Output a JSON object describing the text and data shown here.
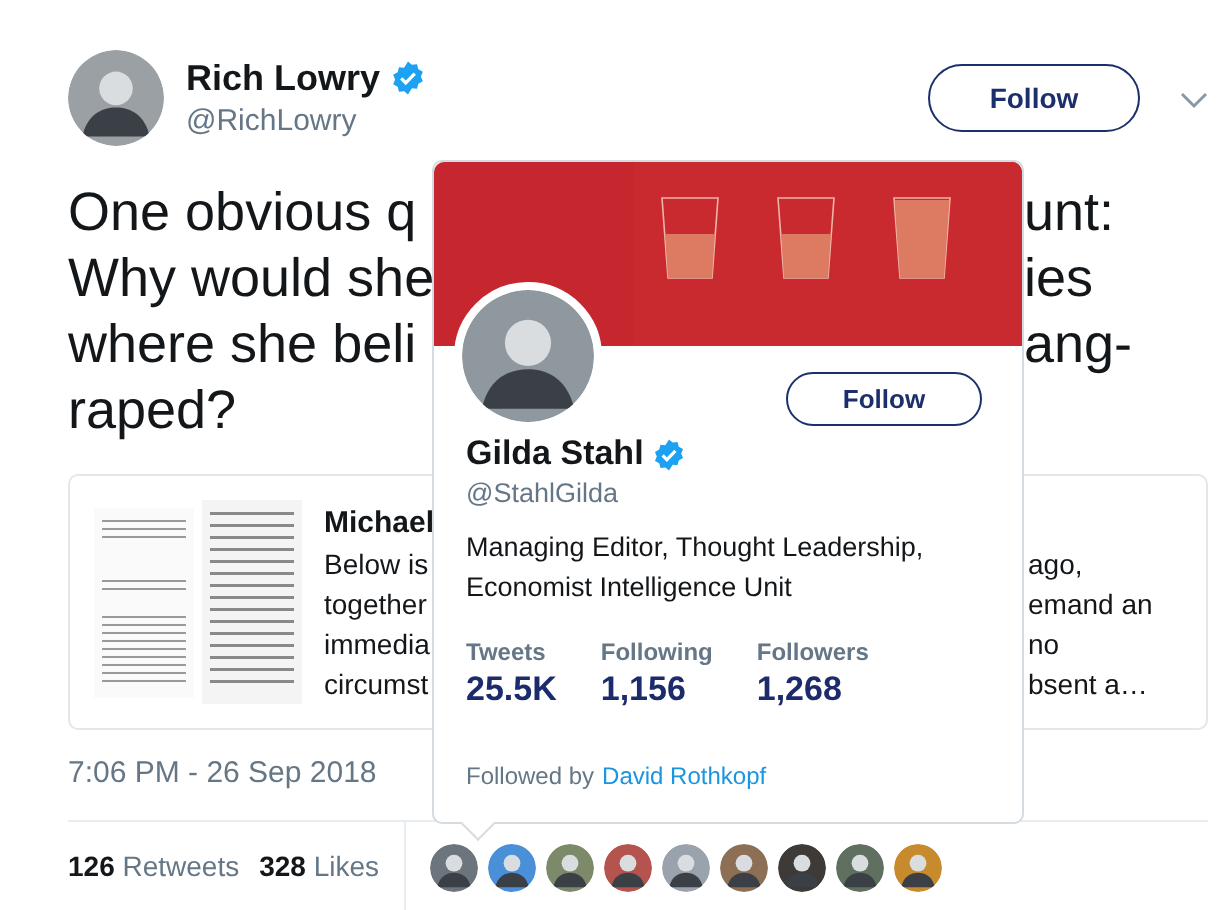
{
  "tweet": {
    "author": {
      "name": "Rich Lowry",
      "handle": "@RichLowry",
      "verified": true
    },
    "follow_button": "Follow",
    "text_lines": [
      {
        "left": "One obvious q",
        "right": "unt:"
      },
      {
        "left": "Why would she",
        "right": "ies"
      },
      {
        "left": "where she beli",
        "right": "ang-"
      },
      {
        "left": "raped?"
      }
    ],
    "link_card": {
      "title": "Michael",
      "lines": [
        {
          "left": "Below is",
          "right": "ago,"
        },
        {
          "left": "together",
          "right": "emand an"
        },
        {
          "left": "immedia",
          "right": "no"
        },
        {
          "left": "circumst",
          "right": "bsent a…"
        }
      ]
    },
    "timestamp": "7:06 PM - 26 Sep 2018",
    "stats": [
      {
        "count": "126",
        "label": "Retweets"
      },
      {
        "count": "328",
        "label": "Likes"
      }
    ],
    "liker_avatars": [
      {
        "kind": "avatar"
      },
      {
        "kind": "avatar"
      },
      {
        "kind": "avatar"
      },
      {
        "kind": "avatar"
      },
      {
        "kind": "avatar"
      },
      {
        "kind": "avatar"
      },
      {
        "kind": "avatar"
      },
      {
        "kind": "avatar"
      },
      {
        "kind": "avatar"
      }
    ]
  },
  "hover_card": {
    "name": "Gilda Stahl",
    "handle": "@StahlGilda",
    "verified": true,
    "follow_button": "Follow",
    "bio": [
      "Managing Editor, Thought Leadership,",
      "Economist Intelligence Unit"
    ],
    "stats": [
      {
        "label": "Tweets",
        "value": "25.5K"
      },
      {
        "label": "Following",
        "value": "1,156"
      },
      {
        "label": "Followers",
        "value": "1,268"
      }
    ],
    "followed_by": {
      "prefix": "Followed by",
      "link": "David Rothkopf"
    }
  }
}
